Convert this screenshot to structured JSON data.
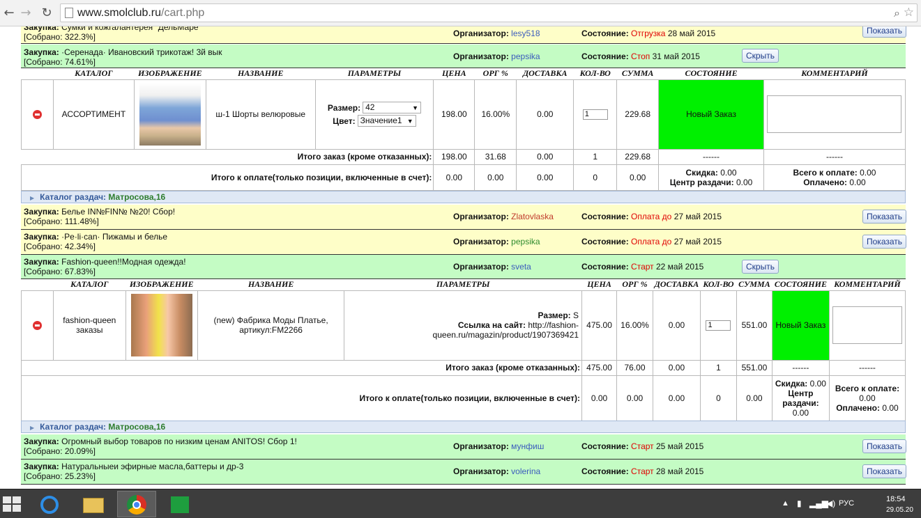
{
  "browser": {
    "url_host": "www.smolclub.ru",
    "url_path": "/cart.php"
  },
  "labels": {
    "purchase": "Закупка:",
    "organizer": "Организатор:",
    "state": "Состояние:",
    "show": "Показать",
    "hide": "Скрыть",
    "catalog_pickup": "Каталог раздач:",
    "size": "Размер:",
    "color": "Цвет:",
    "total_order": "Итого заказ (кроме отказанных):",
    "total_pay": "Итого к оплате(только позиции, включенные в счет):",
    "discount": "Скидка:",
    "pickup_center": "Центр раздачи:",
    "total_due": "Всего к оплате:",
    "paid": "Оплачено:",
    "link_site": "Ссылка на сайт:"
  },
  "headers": [
    "КАТАЛОГ",
    "ИЗОБРАЖЕНИЕ",
    "НАЗВАНИЕ",
    "ПАРАМЕТРЫ",
    "ЦЕНА",
    "ОРГ %",
    "ДОСТАВКА",
    "КОЛ-ВО",
    "СУММА",
    "СОСТОЯНИЕ",
    "КОММЕНТАРИЙ"
  ],
  "purchases": [
    {
      "name": "Сумки и кожгалантерея \"ДельМаре\"",
      "collected": "[Собрано: 322.3%]",
      "organizer": "lesy518",
      "state": "Отгрузка",
      "state_date": "28 май 2015"
    },
    {
      "name": "·Серенада· Ивановский трикотаж! 3й вык",
      "collected": "[Собрано: 74.61%]",
      "organizer": "pepsika",
      "state": "Стоп",
      "state_date": "31 май 2015"
    },
    {
      "name": "Белье IN№FIN№ №20! Сбор!",
      "collected": "[Собрано: 111.48%]",
      "organizer": "Zlatovlaska",
      "state": "Оплата до",
      "state_date": "27 май 2015"
    },
    {
      "name": "·Pe·li·can· Пижамы и белье",
      "collected": "[Собрано: 42.34%]",
      "organizer": "pepsika",
      "state": "Оплата до",
      "state_date": "27 май 2015"
    },
    {
      "name": "Fashion-queen!!Модная одежда!",
      "collected": "[Собрано: 67.83%]",
      "organizer": "sveta",
      "state": "Старт",
      "state_date": "22 май 2015"
    },
    {
      "name": "Огромный выбор товаров по низким ценам ANITOS! Сбор 1!",
      "collected": "[Собрано: 20.09%]",
      "organizer": "мунфиш",
      "state": "Старт",
      "state_date": "25 май 2015"
    },
    {
      "name": "Натуральныеи эфирные масла,баттеры и др-3",
      "collected": "[Собрано: 25.23%]",
      "organizer": "volerina",
      "state": "Старт",
      "state_date": "28 май 2015"
    }
  ],
  "order1": {
    "catalog": "АССОРТИМЕНТ",
    "title": "ш-1 Шорты велюровые",
    "size": "42",
    "color": "Значение1",
    "price": "198.00",
    "org_pct": "16.00%",
    "delivery": "0.00",
    "qty": "1",
    "sum": "229.68",
    "status": "Новый Заказ",
    "total": {
      "price": "198.00",
      "org": "31.68",
      "delivery": "0.00",
      "qty": "1",
      "sum": "229.68",
      "status": "------",
      "comment": "------"
    },
    "pay": {
      "price": "0.00",
      "org": "0.00",
      "delivery": "0.00",
      "qty": "0",
      "sum": "0.00",
      "discount": "0.00",
      "center": "0.00",
      "due": "0.00",
      "paid": "0.00"
    }
  },
  "order2": {
    "catalog": "fashion-queen заказы",
    "title": "(new) Фабрика Моды Платье, артикул:FM2266",
    "size": "S",
    "link": "http://fashion-queen.ru/magazin/product/1907369421",
    "price": "475.00",
    "org_pct": "16.00%",
    "delivery": "0.00",
    "qty": "1",
    "sum": "551.00",
    "status": "Новый Заказ",
    "total": {
      "price": "475.00",
      "org": "76.00",
      "delivery": "0.00",
      "qty": "1",
      "sum": "551.00",
      "status": "------",
      "comment": "------"
    },
    "pay": {
      "price": "0.00",
      "org": "0.00",
      "delivery": "0.00",
      "qty": "0",
      "sum": "0.00",
      "discount": "0.00",
      "center": "0.00",
      "due": "0.00",
      "paid": "0.00"
    }
  },
  "pickup": "Матросова,16",
  "taskbar": {
    "lang": "РУС",
    "time": "18:54",
    "date": "29.05.20"
  }
}
